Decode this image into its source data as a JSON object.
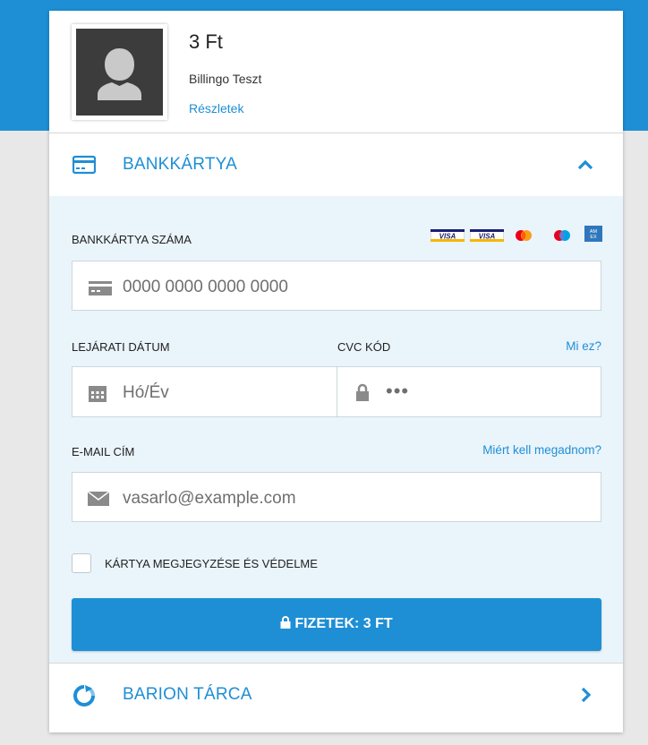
{
  "merchant": {
    "amount": "3 Ft",
    "name": "Billingo Teszt",
    "details_link": "Részletek"
  },
  "card_section": {
    "title": "BANKKÁRTYA",
    "icon": "credit-card-icon",
    "expanded": true
  },
  "form": {
    "card_number": {
      "label": "BANKKÁRTYA SZÁMA",
      "placeholder": "0000 0000 0000 0000"
    },
    "accepted_brands": [
      "VISA",
      "VISA Electron",
      "Mastercard",
      "Maestro",
      "American Express"
    ],
    "expiry": {
      "label": "LEJÁRATI DÁTUM",
      "placeholder": "Hó/Év"
    },
    "cvc": {
      "label": "CVC KÓD",
      "placeholder": "•••",
      "help_link": "Mi ez?"
    },
    "email": {
      "label": "E-MAIL CÍM",
      "placeholder": "vasarlo@example.com",
      "help_link": "Miért kell megadnom?"
    },
    "remember": {
      "label": "KÁRTYA MEGJEGYZÉSE ÉS VÉDELME",
      "checked": false
    },
    "pay_button": "FIZETEK: 3 FT"
  },
  "wallet_section": {
    "title": "BARION TÁRCA",
    "icon": "barion-logo-icon"
  },
  "colors": {
    "accent": "#1e8fd5",
    "form_background": "#eaf4fb",
    "page_background": "#e8e8e8"
  }
}
